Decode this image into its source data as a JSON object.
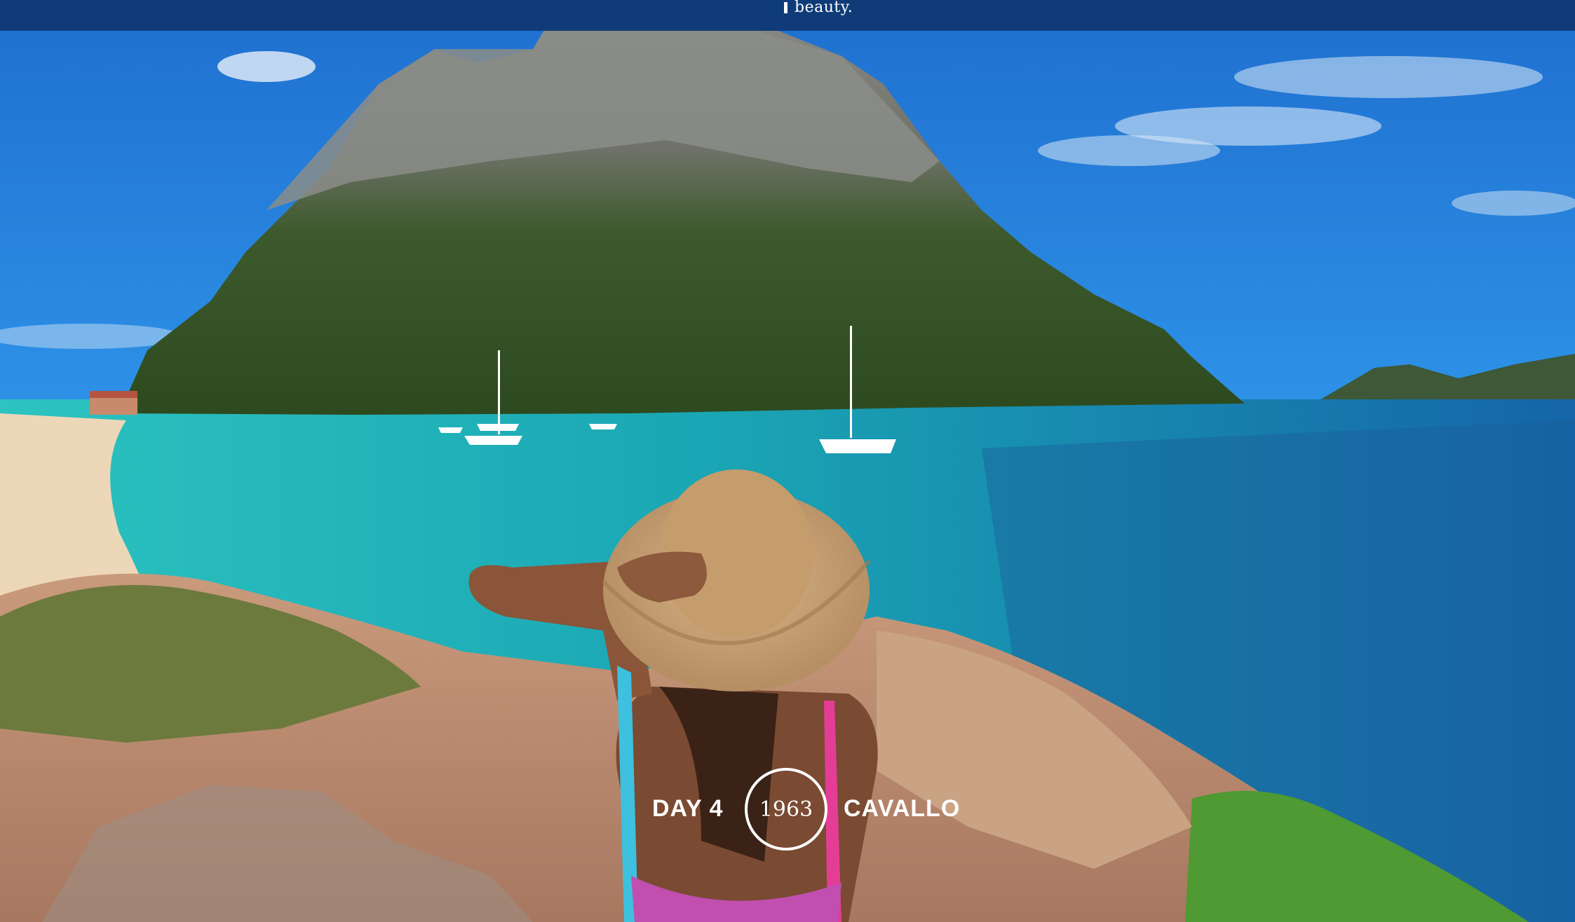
{
  "header": {
    "text": "beauty."
  },
  "hero": {
    "day_label": "DAY 4",
    "year": "1963",
    "place": "CAVALLO"
  },
  "colors": {
    "header_bg": "#0f3c79",
    "sky": "#1d79d2",
    "sea_turquoise": "#1fb6b6",
    "sea_deep": "#1b6ea8"
  }
}
